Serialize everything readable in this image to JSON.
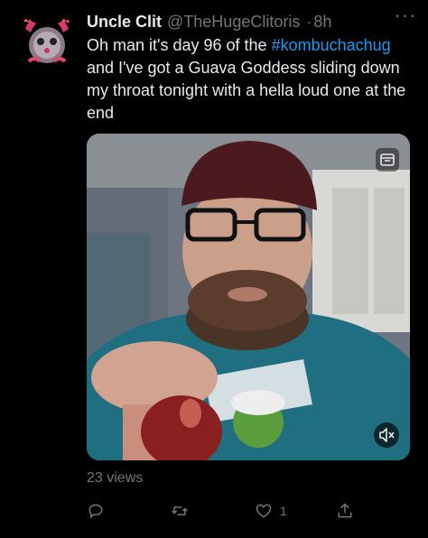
{
  "tweet": {
    "author_name": "Uncle Clit",
    "author_handle": "@TheHugeClitoris",
    "separator": "·",
    "timestamp": "8h",
    "more_label": "···",
    "text_before": "Oh man it's day 96 of the ",
    "hashtag": "#kombuchachug",
    "text_after": " and I've got a Guava Goddess sliding down my throat tonight with a hella loud one at the end",
    "views": "23 views",
    "like_count": "1"
  },
  "icons": {
    "reply": "reply-icon",
    "retweet": "retweet-icon",
    "like": "heart-icon",
    "share": "share-icon",
    "mute": "mute-icon",
    "gif": "gif-icon"
  },
  "colors": {
    "background": "#000000",
    "text": "#e7e9ea",
    "muted": "#71767b",
    "link": "#1d9bf0"
  }
}
